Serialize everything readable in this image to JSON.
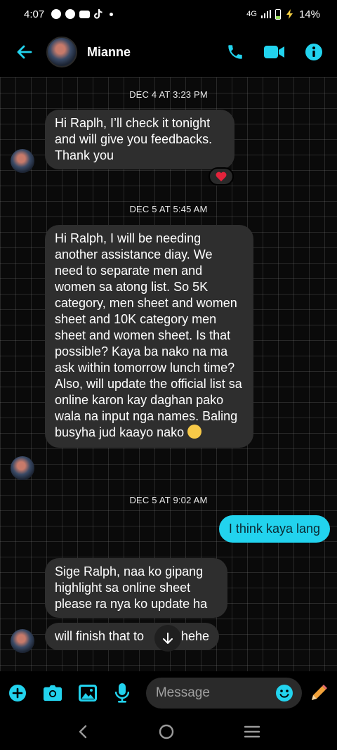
{
  "status_bar": {
    "time": "4:07",
    "network": "4G",
    "battery": "14%"
  },
  "header": {
    "contact_name": "Mianne"
  },
  "colors": {
    "accent": "#22d3ee",
    "incoming_bubble": "#2e2e2e",
    "background": "#000000"
  },
  "messages": [
    {
      "date": "DEC 4 AT 3:23 PM"
    },
    {
      "text": "Hi Raplh, I’ll check it tonight and will give you feedbacks. Thank you",
      "reaction": "heart"
    },
    {
      "date": "DEC 5 AT 5:45 AM"
    },
    {
      "text": "Hi Ralph, I will be needing another assistance diay. We need to separate men and women sa atong list. So 5K category, men sheet and women sheet and 10K category men sheet and women sheet. Is that possible? Kaya ba nako na ma ask within tomorrow lunch time? Also, will update the official list sa online karon kay daghan pako wala na input nga names. Baling busyha jud kaayo nako"
    },
    {
      "date": "DEC 5 AT 9:02 AM"
    },
    {
      "text": "I think kaya lang",
      "outgoing": true
    },
    {
      "text": "Sige Ralph, naa ko gipang highlight sa online sheet please ra nya ko update ha"
    },
    {
      "text_left": "will finish that to",
      "text_right": "hehe"
    }
  ],
  "composer": {
    "placeholder": "Message"
  },
  "icons": {
    "back": "arrow-left-icon",
    "call": "phone-icon",
    "video": "video-camera-icon",
    "info": "info-icon",
    "add": "plus-circle-icon",
    "camera": "camera-icon",
    "gallery": "image-icon",
    "mic": "microphone-icon",
    "emoji": "emoji-icon",
    "pencil": "pencil-icon",
    "scroll": "arrow-down-icon"
  }
}
